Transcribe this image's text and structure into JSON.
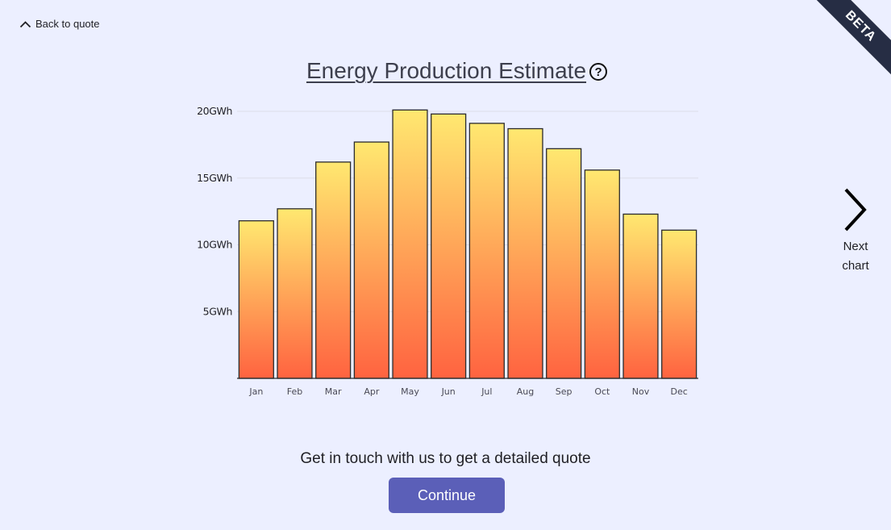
{
  "nav": {
    "back_label": "Back to quote"
  },
  "ribbon": {
    "label": "BETA"
  },
  "header": {
    "title": "Energy Production Estimate",
    "help_glyph": "?"
  },
  "next_chart": {
    "line1": "Next",
    "line2": "chart"
  },
  "cta": {
    "text": "Get in touch with us to get a detailed quote",
    "button_label": "Continue"
  },
  "colors": {
    "background": "#ecefff",
    "button": "#5b5fb8",
    "ribbon": "#262d44",
    "bar_top": "#ffe870",
    "bar_bottom": "#ff6340",
    "bar_stroke": "#2b2b2b"
  },
  "icons": {
    "back": "chevron-up-icon",
    "next": "chevron-right-icon",
    "help": "question-circle-icon"
  },
  "chart_data": {
    "type": "bar",
    "title": "Energy Production Estimate",
    "categories": [
      "Jan",
      "Feb",
      "Mar",
      "Apr",
      "May",
      "Jun",
      "Jul",
      "Aug",
      "Sep",
      "Oct",
      "Nov",
      "Dec"
    ],
    "values": [
      11.8,
      12.7,
      16.2,
      17.7,
      20.1,
      19.8,
      19.1,
      18.7,
      17.2,
      15.6,
      12.3,
      11.1
    ],
    "unit": "GWh",
    "ylim": [
      0,
      20
    ],
    "yticks": [
      {
        "value": 5,
        "label": "5GWh"
      },
      {
        "value": 10,
        "label": "10GWh"
      },
      {
        "value": 15,
        "label": "15GWh"
      },
      {
        "value": 20,
        "label": "20GWh"
      }
    ],
    "grid": true,
    "legend": "none"
  }
}
